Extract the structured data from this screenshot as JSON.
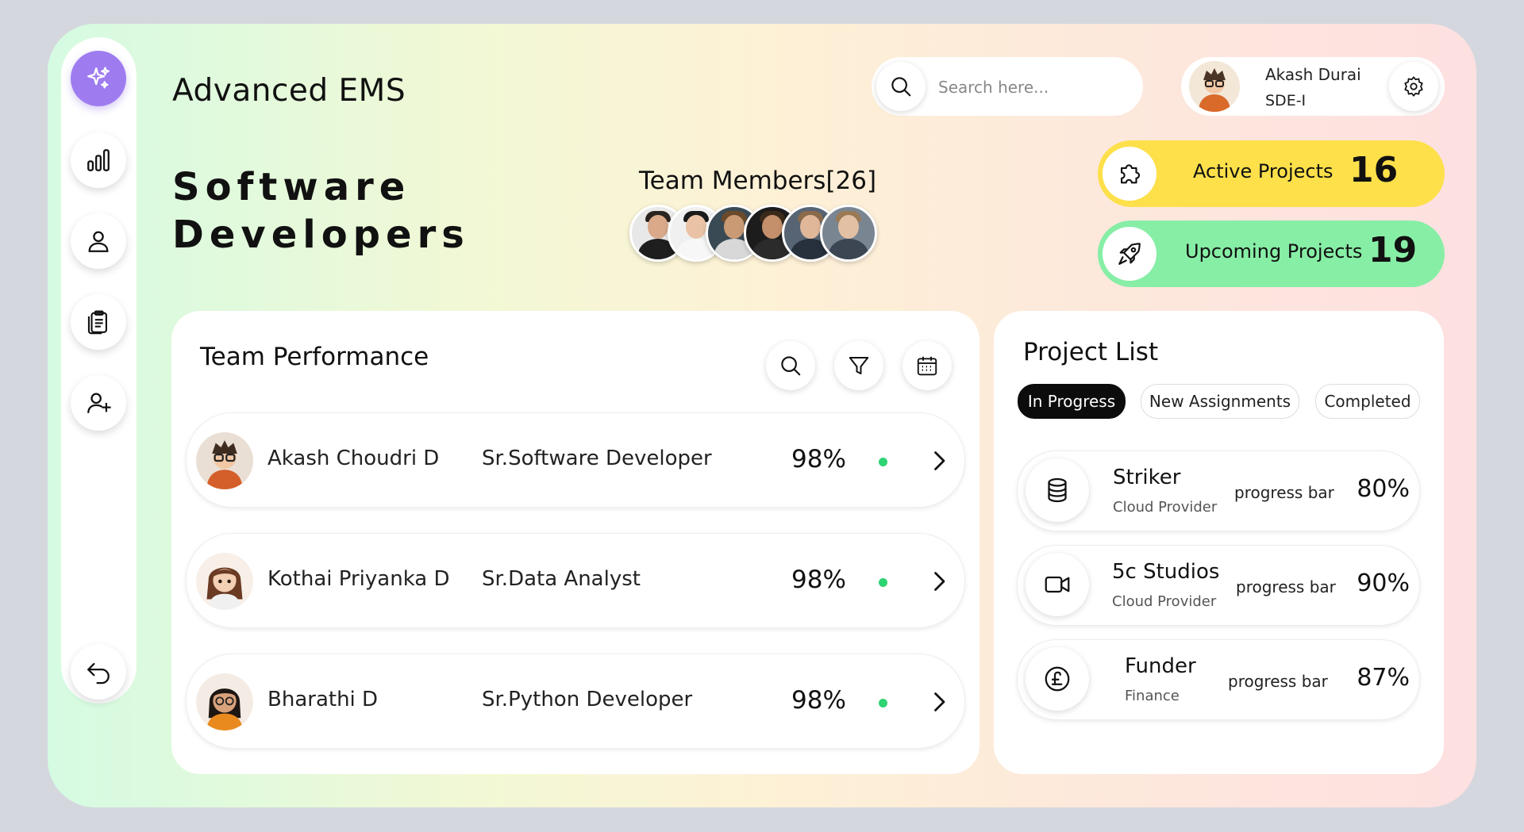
{
  "app": {
    "title": "Advanced EMS"
  },
  "hero": {
    "line1": "Software",
    "line2": "Developers"
  },
  "team": {
    "label": "Team Members[26]",
    "avatars": [
      "member-1",
      "member-2",
      "member-3",
      "member-4",
      "member-5",
      "member-6"
    ]
  },
  "search": {
    "placeholder": "Search here..."
  },
  "profile": {
    "name": "Akash Durai",
    "role": "SDE-I"
  },
  "stats": {
    "active": {
      "label": "Active Projects",
      "value": "16"
    },
    "upcoming": {
      "label": "Upcoming Projects",
      "value": "19"
    }
  },
  "sidebar": {
    "items": [
      {
        "icon": "sparkles-icon",
        "active": true
      },
      {
        "icon": "bar-chart-icon"
      },
      {
        "icon": "user-icon"
      },
      {
        "icon": "clipboard-icon"
      },
      {
        "icon": "user-plus-icon"
      }
    ],
    "bottom_icon": "undo-icon"
  },
  "performance": {
    "title": "Team Performance",
    "rows": [
      {
        "name": "Akash Choudri D",
        "role": "Sr.Software Developer",
        "percent": "98%"
      },
      {
        "name": "Kothai Priyanka D",
        "role": "Sr.Data Analyst",
        "percent": "98%"
      },
      {
        "name": "Bharathi D",
        "role": "Sr.Python Developer",
        "percent": "98%"
      }
    ]
  },
  "projects": {
    "title": "Project List",
    "tabs": [
      "In Progress",
      "New Assignments",
      "Completed"
    ],
    "active_tab": "In Progress",
    "items": [
      {
        "name": "Striker",
        "category": "Cloud Provider",
        "bar_label": "progress bar",
        "percent": "80%",
        "icon": "database-icon"
      },
      {
        "name": "5c Studios",
        "category": "Cloud Provider",
        "bar_label": "progress bar",
        "percent": "90%",
        "icon": "video-icon"
      },
      {
        "name": "Funder",
        "category": "Finance",
        "bar_label": "progress bar",
        "percent": "87%",
        "icon": "pound-icon"
      }
    ]
  },
  "colors": {
    "accent_purple": "#9e7cf0",
    "yellow": "#fde04a",
    "green": "#87eea6",
    "status_dot": "#2ed372"
  }
}
